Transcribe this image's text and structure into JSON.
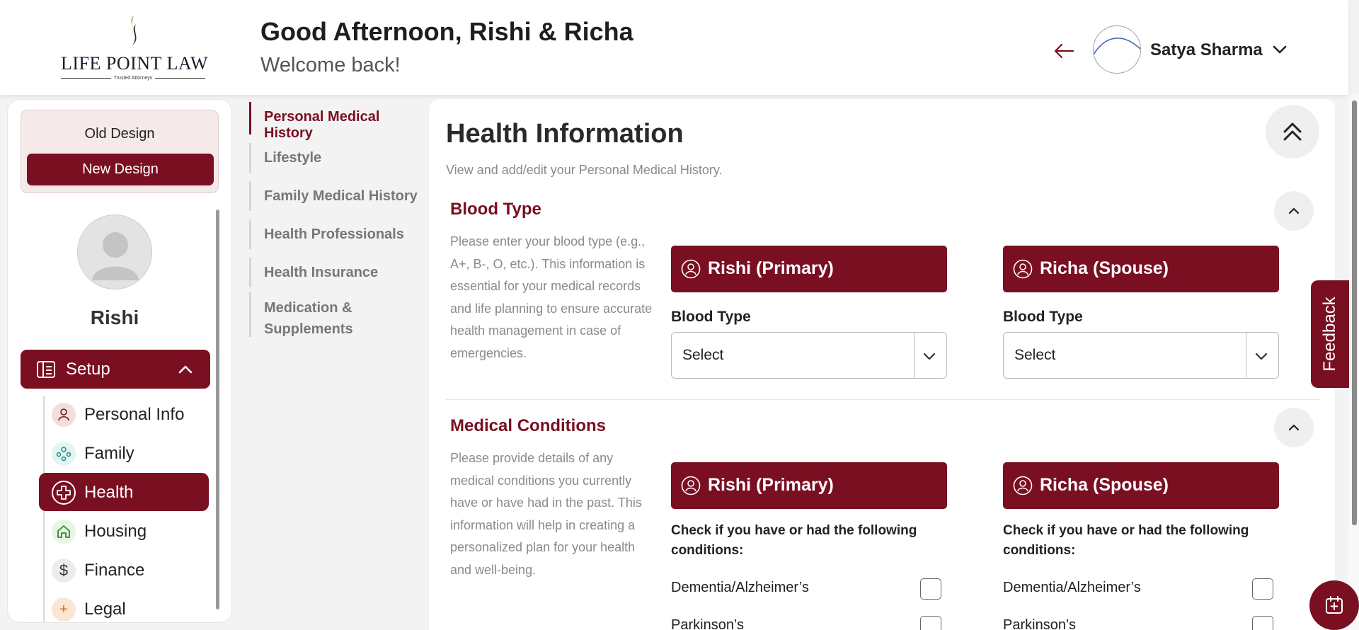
{
  "brand": {
    "name": "LIFE POINT LAW",
    "tagline": "Trusted Attorneys"
  },
  "header": {
    "greeting": "Good Afternoon, Rishi & Richa",
    "welcome": "Welcome back!",
    "user_name": "Satya Sharma",
    "back_icon": "arrow-left-icon",
    "caret_icon": "chevron-down-icon"
  },
  "sidebar": {
    "old_design": "Old Design",
    "new_design": "New Design",
    "profile_name": "Rishi",
    "setup_label": "Setup",
    "items": [
      {
        "label": "Personal Info",
        "icon": "person-icon",
        "active": false
      },
      {
        "label": "Family",
        "icon": "family-icon",
        "active": false
      },
      {
        "label": "Health",
        "icon": "health-cross-icon",
        "active": true
      },
      {
        "label": "Housing",
        "icon": "home-icon",
        "active": false
      },
      {
        "label": "Finance",
        "icon": "dollar-icon",
        "active": false
      },
      {
        "label": "Legal",
        "icon": "legal-icon",
        "active": false
      }
    ]
  },
  "section_nav": {
    "items": [
      {
        "label": "Personal Medical History",
        "active": true
      },
      {
        "label": "Lifestyle",
        "active": false
      },
      {
        "label": "Family Medical History",
        "active": false
      },
      {
        "label": "Health Professionals",
        "active": false
      },
      {
        "label": "Health Insurance",
        "active": false
      },
      {
        "label": "Medication & Supplements",
        "active": false
      }
    ]
  },
  "main": {
    "title": "Health Information",
    "subtitle": "View and add/edit your Personal Medical History.",
    "blood_type": {
      "title": "Blood Type",
      "description": "Please enter your blood type (e.g., A+, B-, O, etc.). This information is essential for your medical records and life planning to ensure accurate health management in case of emergencies.",
      "primary_name": "Rishi (Primary)",
      "spouse_name": "Richa (Spouse)",
      "field_label": "Blood Type",
      "select_value": "Select"
    },
    "medical_conditions": {
      "title": "Medical Conditions",
      "description": "Please provide details of any medical conditions you currently have or have had in the past. This information will help in creating a personalized plan for your health and well-being.",
      "primary_name": "Rishi (Primary)",
      "spouse_name": "Richa (Spouse)",
      "check_heading": "Check if you have or had the following conditions:",
      "conditions": [
        "Dementia/Alzheimer’s",
        "Parkinson’s"
      ]
    }
  },
  "widgets": {
    "feedback": "Feedback"
  },
  "colors": {
    "brand": "#7a0f22",
    "muted_text": "#8a8a8a"
  }
}
